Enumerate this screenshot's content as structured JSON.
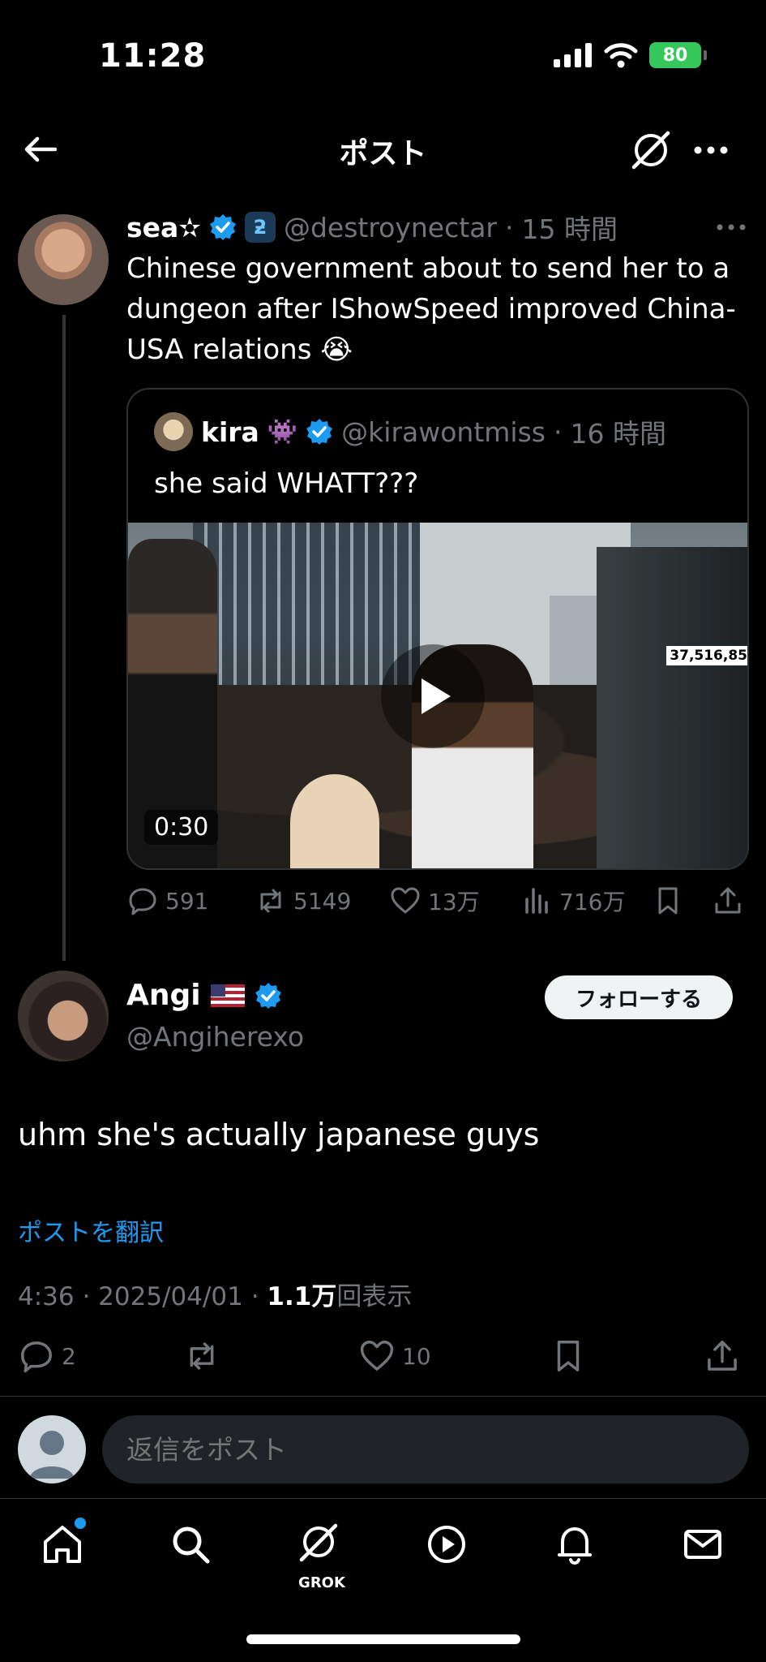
{
  "status_bar": {
    "time": "11:28",
    "battery": "80"
  },
  "nav": {
    "title": "ポスト"
  },
  "parent_tweet": {
    "name": "sea✫",
    "handle": "@destroynectar",
    "time": "15 時間",
    "text": "Chinese government about to send her to a dungeon after IShowSpeed improved China-USA relations 😭",
    "quote": {
      "name": "kira",
      "emoji": "👾",
      "handle": "@kirawontmiss",
      "time": "16 時間",
      "text": "she said WHATT???",
      "video_duration": "0:30",
      "overlay_count": "37,516,85"
    },
    "stats": {
      "replies": "591",
      "reposts": "5149",
      "likes": "13万",
      "views": "716万"
    }
  },
  "main_tweet": {
    "name": "Angi",
    "handle": "@Angiherexo",
    "follow_label": "フォローする",
    "text": "uhm she's actually japanese guys",
    "translate_label": "ポストを翻訳",
    "timestamp": "4:36 · 2025/04/01 · ",
    "views_count": "1.1万",
    "views_label": "回表示",
    "stats": {
      "replies": "2",
      "likes": "10"
    }
  },
  "reply": {
    "placeholder": "返信をポスト"
  },
  "tabbar": {
    "grok_label": "GROK"
  },
  "colors": {
    "accent": "#1d9bf0",
    "background": "#000000",
    "muted": "#71767b"
  }
}
